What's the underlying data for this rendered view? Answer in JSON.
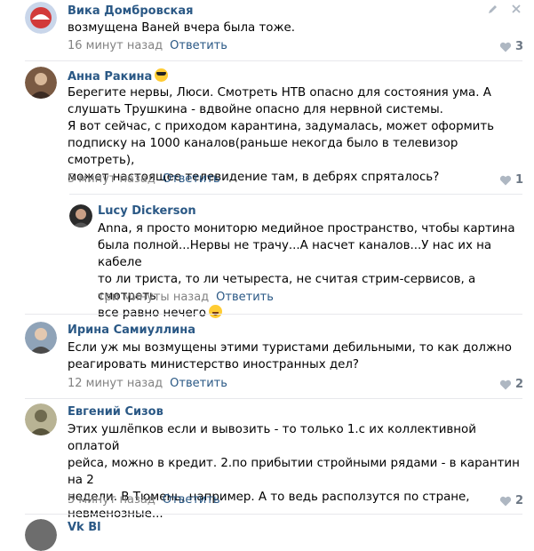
{
  "comments": [
    {
      "author": "Вика Домбровская",
      "text_lines": [
        "возмущена Ваней вчера была тоже."
      ],
      "time": "16 минут назад",
      "reply": "Ответить",
      "likes": "3"
    },
    {
      "author": "Анна Ракина",
      "text_lines": [
        "Берегите нервы, Люси. Смотреть НТВ опасно для состояния ума. А",
        "слушать Трушкина - вдвойне опасно для нервной системы.",
        "Я вот сейчас, с приходом карантина, задумалась, может оформить",
        "подписку на 1000 каналов(раньше некогда было в телевизор смотреть),",
        "может настоящее телевидение там, в дебрях спряталось?"
      ],
      "time": "5 минут назад",
      "reply": "Ответить",
      "likes": "1"
    },
    {
      "author": "Lucy Dickerson",
      "text_lines": [
        "Anna, я просто мониторю медийное пространство, чтобы картина",
        "была полной...Нервы не трачу...А насчет каналов...У нас их на кабеле",
        "то ли триста, то ли четыреста, не считая стрим-сервисов, а смотреть",
        "все равно нечего"
      ],
      "time": "три минуты назад",
      "reply": "Ответить"
    },
    {
      "author": "Ирина Самиуллина",
      "text_lines": [
        "Если уж мы возмущены этими туристами дебильными, то как должно",
        "реагировать министерство иностранных дел?"
      ],
      "time": "12 минут назад",
      "reply": "Ответить",
      "likes": "2"
    },
    {
      "author": "Евгений Сизов",
      "text_lines": [
        "Этих ушлёпков если и вывозить - то только 1.с их коллективной оплатой",
        "рейса, можно в кредит. 2.по прибытии стройными рядами - в карантин на 2",
        "недели. В Тюмень, например. А то ведь расползутся по стране,",
        "невменозные..."
      ],
      "time": "5 минут назад",
      "reply": "Ответить",
      "likes": "2"
    },
    {
      "author": "Vk Bl"
    }
  ],
  "colors": {
    "link": "#2a5885",
    "meta": "#828282",
    "separator": "#e7e8ec",
    "like": "#6d7885"
  },
  "icons": [
    "pencil-icon",
    "close-icon",
    "heart-icon",
    "sunglasses-emoji",
    "laughing-emoji"
  ]
}
